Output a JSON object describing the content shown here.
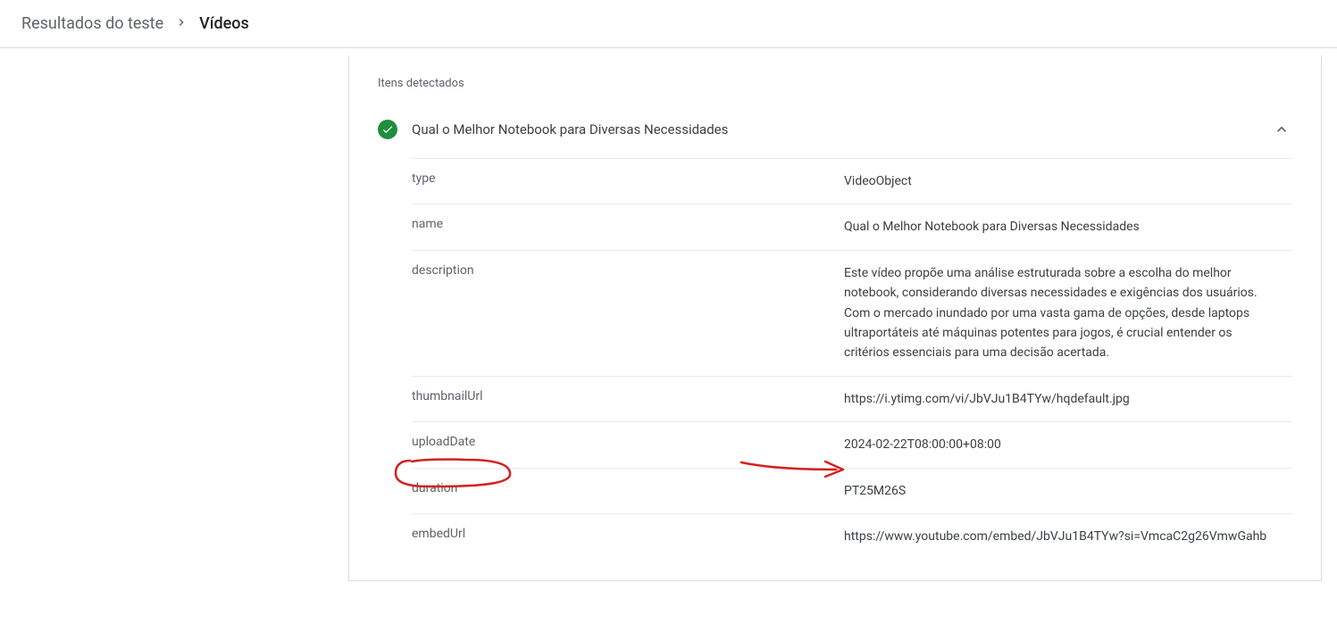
{
  "breadcrumb": {
    "parent": "Resultados do teste",
    "current": "Vídeos"
  },
  "section": {
    "heading": "Itens detectados",
    "item_title": "Qual o Melhor Notebook para Diversas Necessidades"
  },
  "properties": [
    {
      "key": "type",
      "value": "VideoObject"
    },
    {
      "key": "name",
      "value": "Qual o Melhor Notebook para Diversas Necessidades"
    },
    {
      "key": "description",
      "value": "Este vídeo propõe uma análise estruturada sobre a escolha do melhor notebook, considerando diversas necessidades e exigências dos usuários. Com o mercado inundado por uma vasta gama de opções, desde laptops ultraportáteis até máquinas potentes para jogos, é crucial entender os critérios essenciais para uma decisão acertada."
    },
    {
      "key": "thumbnailUrl",
      "value": "https://i.ytimg.com/vi/JbVJu1B4TYw/hqdefault.jpg"
    },
    {
      "key": "uploadDate",
      "value": "2024-02-22T08:00:00+08:00"
    },
    {
      "key": "duration",
      "value": "PT25M26S"
    },
    {
      "key": "embedUrl",
      "value": "https://www.youtube.com/embed/JbVJu1B4TYw?si=VmcaC2g26VmwGahb"
    }
  ]
}
